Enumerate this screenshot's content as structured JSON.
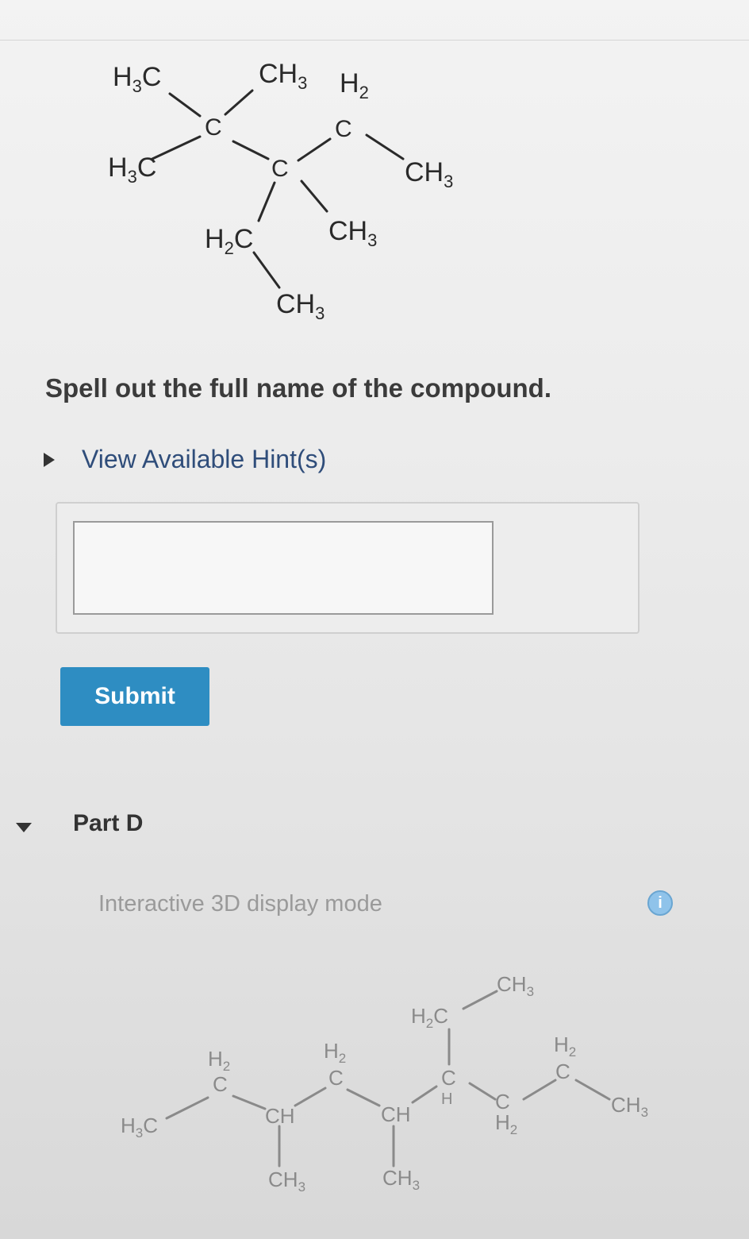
{
  "structure_c": {
    "atoms": [
      {
        "main": "H",
        "sub": "3",
        "tail": "C"
      },
      {
        "main": "H",
        "sub": "3",
        "tail": "C"
      },
      {
        "main": "CH",
        "sub": "3",
        "tail": ""
      },
      {
        "main": "H",
        "sub": "2",
        "tail": ""
      },
      {
        "main": "C",
        "sub": "",
        "tail": ""
      },
      {
        "main": "C",
        "sub": "",
        "tail": ""
      },
      {
        "main": "C",
        "sub": "",
        "tail": ""
      },
      {
        "main": "CH",
        "sub": "3",
        "tail": ""
      },
      {
        "main": "H",
        "sub": "2",
        "tail": "C"
      },
      {
        "main": "CH",
        "sub": "3",
        "tail": ""
      },
      {
        "main": "CH",
        "sub": "3",
        "tail": ""
      }
    ]
  },
  "question": {
    "instruction": "Spell out the full name of the compound.",
    "hint_link": "View Available Hint(s)",
    "answer_value": "",
    "submit_label": "Submit"
  },
  "part_d": {
    "title": "Part D",
    "mode_label": "Interactive 3D display mode",
    "info_icon": "info-icon",
    "atoms": [
      {
        "main": "H",
        "sub": "3",
        "tail": "C"
      },
      {
        "main": "H",
        "sub": "2",
        "tail": ""
      },
      {
        "main": "C",
        "sub": "",
        "tail": ""
      },
      {
        "main": "CH",
        "sub": "",
        "tail": ""
      },
      {
        "main": "CH",
        "sub": "3",
        "tail": ""
      },
      {
        "main": "H",
        "sub": "2",
        "tail": ""
      },
      {
        "main": "C",
        "sub": "",
        "tail": ""
      },
      {
        "main": "CH",
        "sub": "",
        "tail": ""
      },
      {
        "main": "CH",
        "sub": "3",
        "tail": ""
      },
      {
        "main": "H",
        "sub": "2",
        "tail": "C"
      },
      {
        "main": "CH",
        "sub": "3",
        "tail": ""
      },
      {
        "main": "C",
        "sub": "",
        "tail": ""
      },
      {
        "main": "H",
        "sub": "",
        "tail": ""
      },
      {
        "main": "C",
        "sub": "",
        "tail": ""
      },
      {
        "main": "H",
        "sub": "2",
        "tail": ""
      },
      {
        "main": "H",
        "sub": "2",
        "tail": ""
      },
      {
        "main": "C",
        "sub": "",
        "tail": ""
      },
      {
        "main": "CH",
        "sub": "3",
        "tail": ""
      }
    ]
  }
}
